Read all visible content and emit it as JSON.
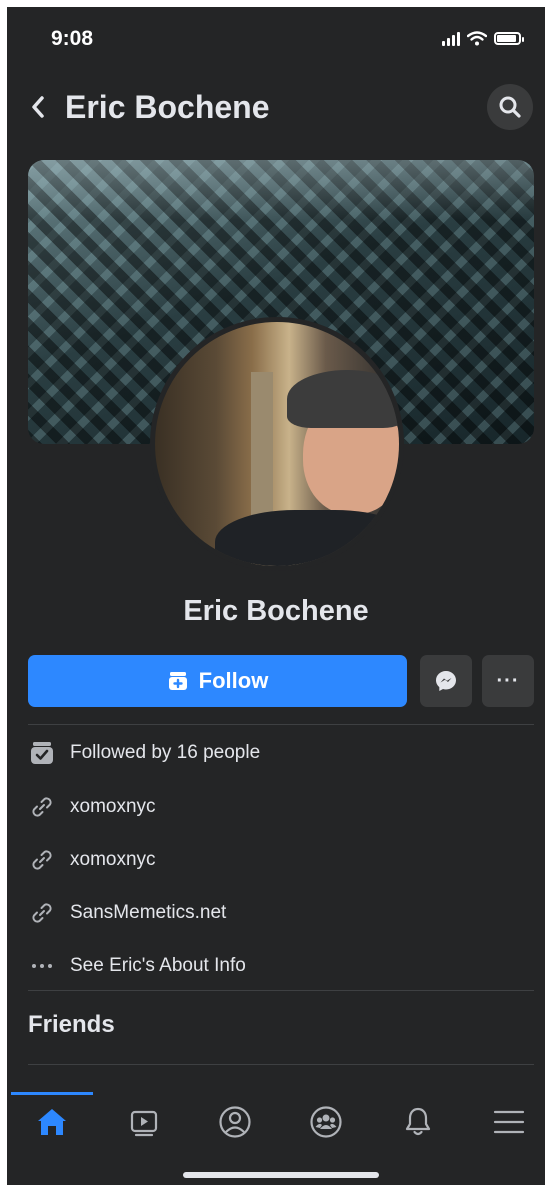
{
  "status_bar": {
    "time": "9:08"
  },
  "header": {
    "title": "Eric Bochene",
    "back_icon": "chevron-left-icon",
    "search_icon": "search-icon"
  },
  "profile": {
    "name": "Eric Bochene"
  },
  "actions": {
    "follow_label": "Follow",
    "more_label": "···"
  },
  "info": [
    {
      "icon": "followers-icon",
      "text": "Followed by 16 people"
    },
    {
      "icon": "link-icon",
      "text": "xomoxnyc"
    },
    {
      "icon": "link-icon",
      "text": "xomoxnyc"
    },
    {
      "icon": "link-icon",
      "text": "SansMemetics.net"
    },
    {
      "icon": "more-dots-icon",
      "text": "See Eric's About Info"
    }
  ],
  "sections": {
    "friends_title": "Friends"
  },
  "colors": {
    "accent": "#2d88ff",
    "background": "#242526",
    "button_bg": "#3a3b3c",
    "text": "#e4e6eb"
  },
  "tabbar": [
    {
      "icon": "home-icon",
      "active": true
    },
    {
      "icon": "watch-icon",
      "active": false
    },
    {
      "icon": "profile-icon",
      "active": false
    },
    {
      "icon": "groups-icon",
      "active": false
    },
    {
      "icon": "bell-icon",
      "active": false
    },
    {
      "icon": "menu-icon",
      "active": false
    }
  ]
}
